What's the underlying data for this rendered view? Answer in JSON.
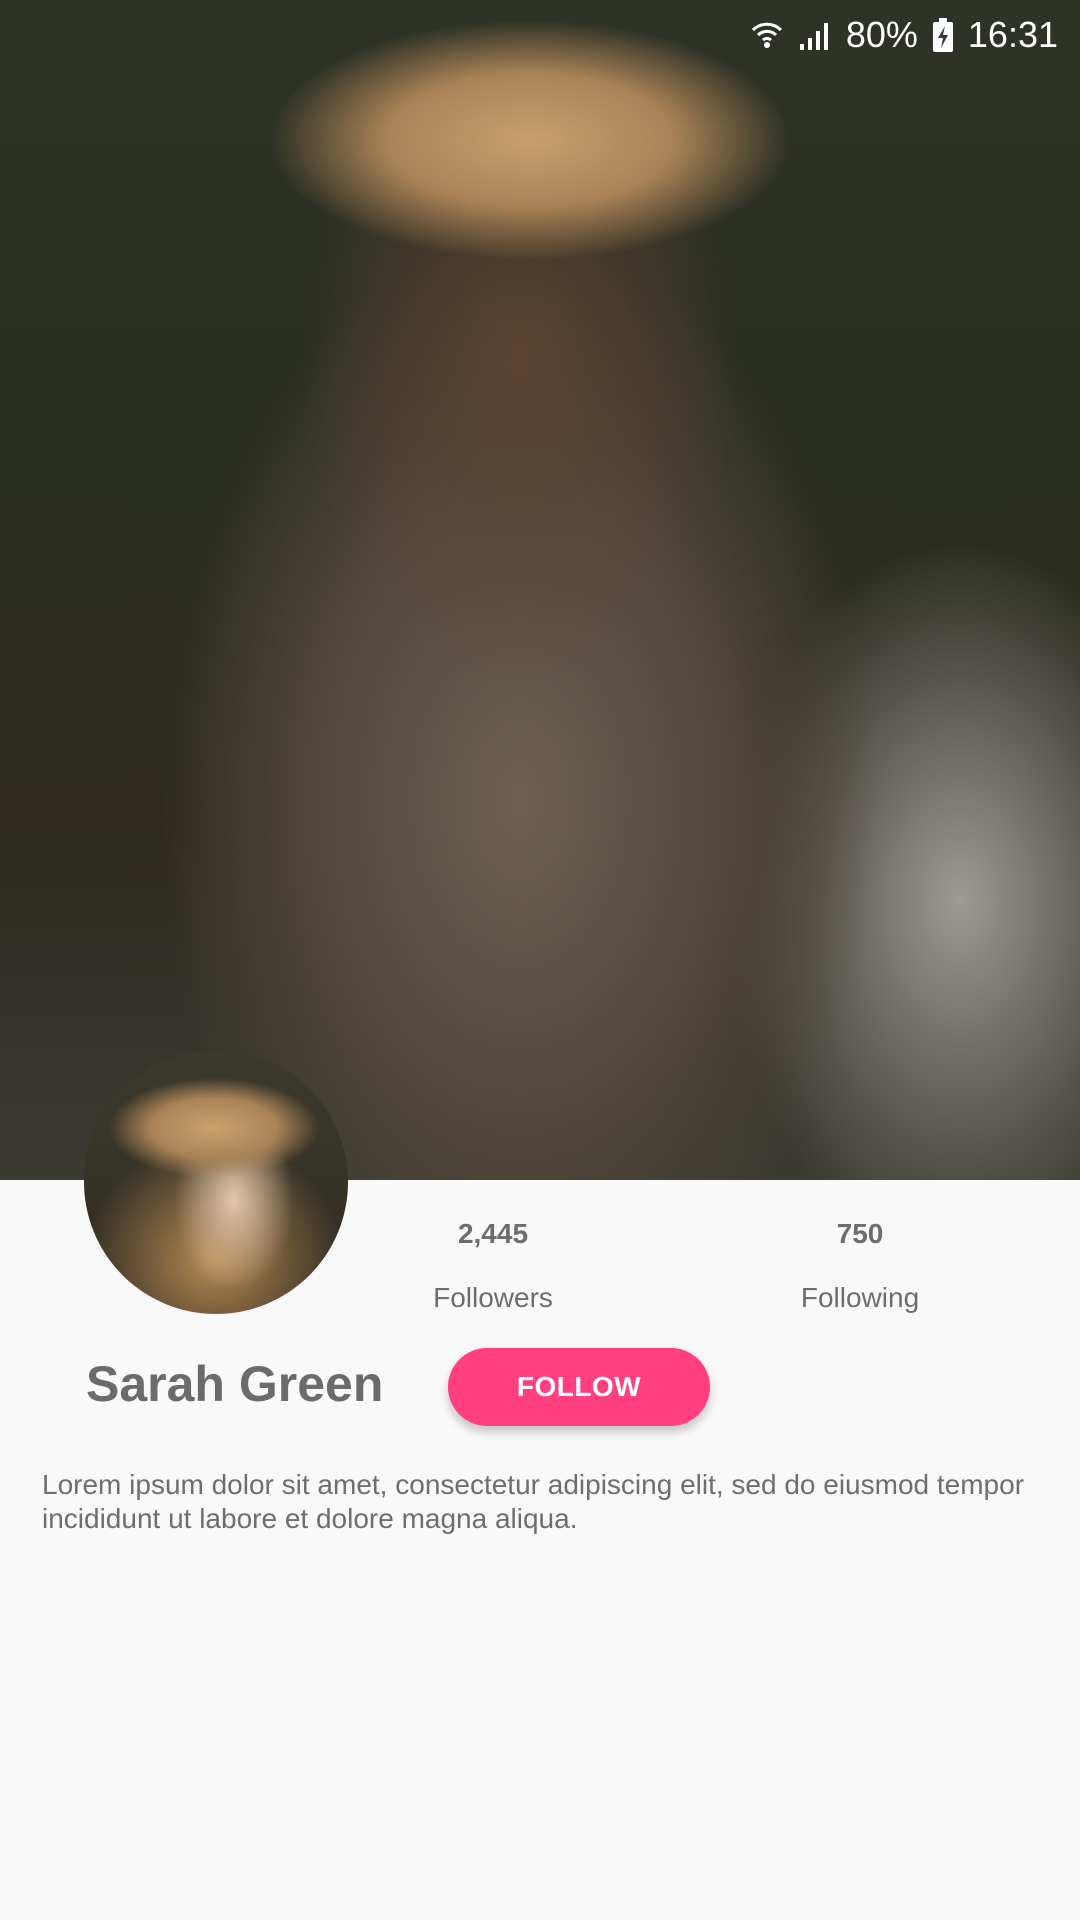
{
  "status_bar": {
    "battery": "80%",
    "time": "16:31",
    "icons": [
      "wifi-icon",
      "signal-icon",
      "battery-charging-icon"
    ]
  },
  "profile": {
    "name": "Sarah Green",
    "followers_count": "2,445",
    "followers_label": "Followers",
    "following_count": "750",
    "following_label": "Following",
    "follow_button": "FOLLOW",
    "bio": "Lorem ipsum dolor sit amet, consectetur adipiscing elit, sed do eiusmod tempor incididunt ut labore et dolore magna aliqua."
  },
  "colors": {
    "accent": "#ff3f80",
    "background": "#f9f9fa",
    "text": "#6d6d6d"
  }
}
